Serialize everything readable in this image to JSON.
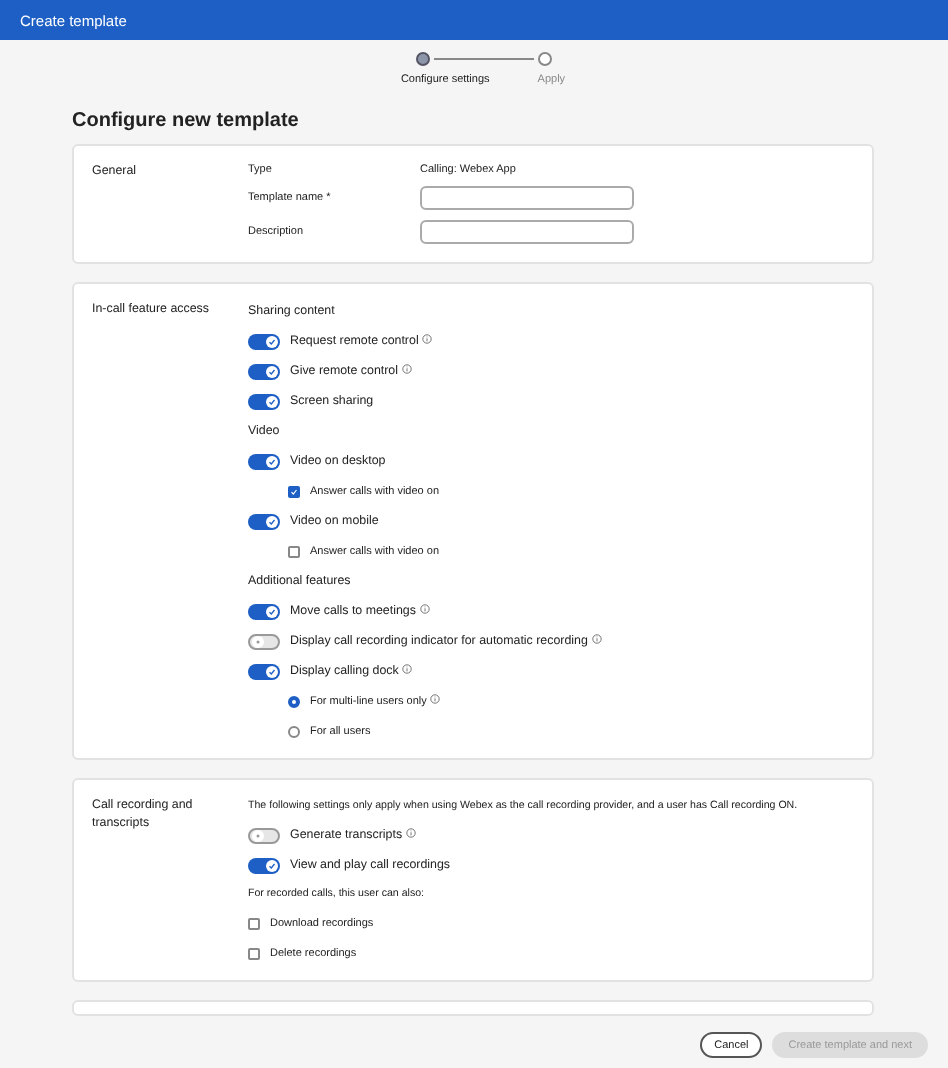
{
  "header": {
    "title": "Create template"
  },
  "steps": [
    {
      "label": "Configure settings",
      "selected": true
    },
    {
      "label": "Apply",
      "selected": false
    }
  ],
  "page_title": "Configure new template",
  "general": {
    "label": "General",
    "fields": [
      {
        "kind": "text",
        "label": "Type",
        "value": "Calling: Webex App"
      },
      {
        "kind": "input",
        "label": "Template name *"
      },
      {
        "kind": "input",
        "label": "Description"
      }
    ]
  },
  "in_call": {
    "label": "In-call feature access",
    "rows": [
      {
        "kind": "heading",
        "label": "Sharing content"
      },
      {
        "kind": "toggle",
        "label": "Request remote control",
        "on": true,
        "info": true
      },
      {
        "kind": "toggle",
        "label": "Give remote control",
        "on": true,
        "info": true
      },
      {
        "kind": "toggle",
        "label": "Screen sharing",
        "on": true,
        "info": false
      },
      {
        "kind": "heading",
        "label": "Video"
      },
      {
        "kind": "toggle",
        "label": "Video on desktop",
        "on": true,
        "info": false
      },
      {
        "kind": "checkbox",
        "label": "Answer calls with video on",
        "checked": true
      },
      {
        "kind": "toggle",
        "label": "Video on mobile",
        "on": true,
        "info": false
      },
      {
        "kind": "checkbox",
        "label": "Answer calls with video on",
        "checked": false
      },
      {
        "kind": "heading",
        "label": "Additional features"
      },
      {
        "kind": "toggle",
        "label": "Move calls to meetings",
        "on": true,
        "info": true
      },
      {
        "kind": "toggle",
        "label": "Display call recording indicator for automatic recording",
        "on": false,
        "info": true
      },
      {
        "kind": "toggle",
        "label": "Display calling dock",
        "on": true,
        "info": true
      },
      {
        "kind": "radio",
        "label": "For multi-line users only",
        "selected": true,
        "info": true
      },
      {
        "kind": "radio",
        "label": "For all users",
        "selected": false,
        "info": false
      }
    ]
  },
  "recording": {
    "label": "Call recording and transcripts",
    "rows": [
      {
        "kind": "note",
        "label": "The following settings only apply when using Webex as the call recording provider, and a user has Call recording ON."
      },
      {
        "kind": "toggle",
        "label": "Generate transcripts",
        "on": false,
        "info": true
      },
      {
        "kind": "toggle",
        "label": "View and play call recordings",
        "on": true,
        "info": false
      },
      {
        "kind": "note",
        "label": "For recorded calls, this user can also:"
      },
      {
        "kind": "plaincheck",
        "label": "Download recordings",
        "checked": false
      },
      {
        "kind": "plaincheck",
        "label": "Delete recordings",
        "checked": false
      }
    ]
  },
  "buttons": [
    {
      "label": "Cancel",
      "disabled": false
    },
    {
      "label": "Create template and next",
      "disabled": true
    }
  ]
}
